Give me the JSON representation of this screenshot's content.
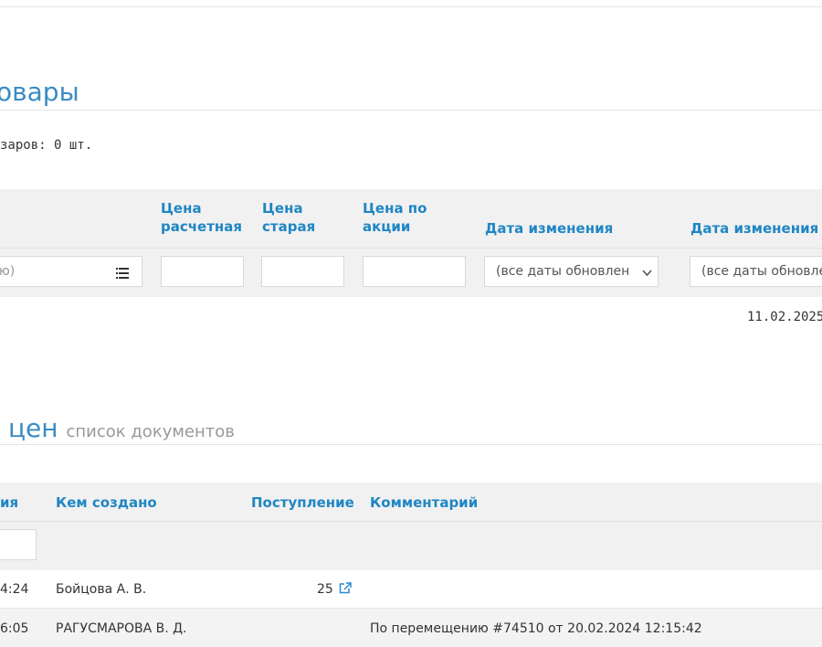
{
  "products_section": {
    "title": "овары",
    "count_text": "заров: 0 шт."
  },
  "products_table": {
    "headers": {
      "price_calc": "Цена расчетная",
      "price_calc_l1": "Цена",
      "price_calc_l2": "расчетная",
      "price_old_l1": "Цена",
      "price_old_l2": "старая",
      "price_promo_l1": "Цена по",
      "price_promo_l2": "акции",
      "date_changed_1": "Дата изменения",
      "date_changed_2": "Дата изменения"
    },
    "filters": {
      "name_placeholder": "ю)",
      "date_select_1": "(все даты обновлен",
      "date_select_2": "(все даты обновле"
    },
    "row_date": "11.02.2025"
  },
  "price_docs_section": {
    "title": "цен",
    "subtitle": "список документов"
  },
  "docs_table": {
    "headers": {
      "created_time": "ия",
      "created_by": "Кем создано",
      "receipt": "Поступление",
      "comment": "Комментарий"
    },
    "rows": [
      {
        "time": "4:24",
        "author": "Бойцова А. В.",
        "receipt": "25",
        "comment": ""
      },
      {
        "time": "6:05",
        "author": "РАГУСМАРОВА В. Д.",
        "receipt": "",
        "comment": "По перемещению #74510 от 20.02.2024 12:15:42"
      }
    ]
  },
  "colors": {
    "accent": "#3a8cc4",
    "header_text": "#1f86c4",
    "band_gray": "#f0f0f0"
  }
}
